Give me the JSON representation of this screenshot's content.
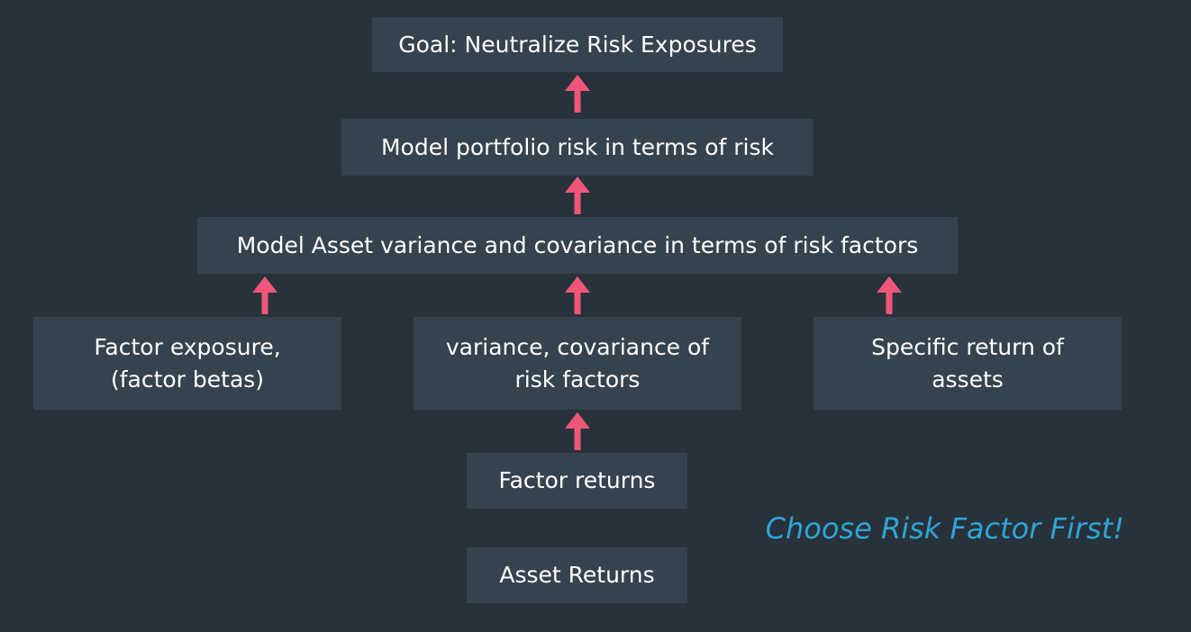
{
  "diagram": {
    "nodes": {
      "goal": [
        "Goal: Neutralize Risk Exposures"
      ],
      "portfolio_risk": [
        "Model portfolio risk in terms of risk"
      ],
      "asset_variance": [
        "Model Asset variance and covariance in terms of risk factors"
      ],
      "factor_exposure": [
        "Factor exposure,",
        "(factor betas)"
      ],
      "factor_covariance": [
        "variance, covariance of",
        "risk factors"
      ],
      "specific_return": [
        "Specific return of",
        "assets"
      ],
      "factor_returns": [
        "Factor returns"
      ],
      "asset_returns": [
        "Asset Returns"
      ]
    },
    "edges": [
      {
        "from": "portfolio_risk",
        "to": "goal"
      },
      {
        "from": "asset_variance",
        "to": "portfolio_risk"
      },
      {
        "from": "factor_exposure",
        "to": "asset_variance"
      },
      {
        "from": "factor_covariance",
        "to": "asset_variance"
      },
      {
        "from": "specific_return",
        "to": "asset_variance"
      },
      {
        "from": "factor_returns",
        "to": "factor_covariance"
      }
    ],
    "note": "Choose Risk Factor First!",
    "colors": {
      "background": "#27323a",
      "box": "#35434e",
      "text": "#ffffff",
      "arrow": "#f2557a",
      "note": "#2fa5d6"
    }
  }
}
